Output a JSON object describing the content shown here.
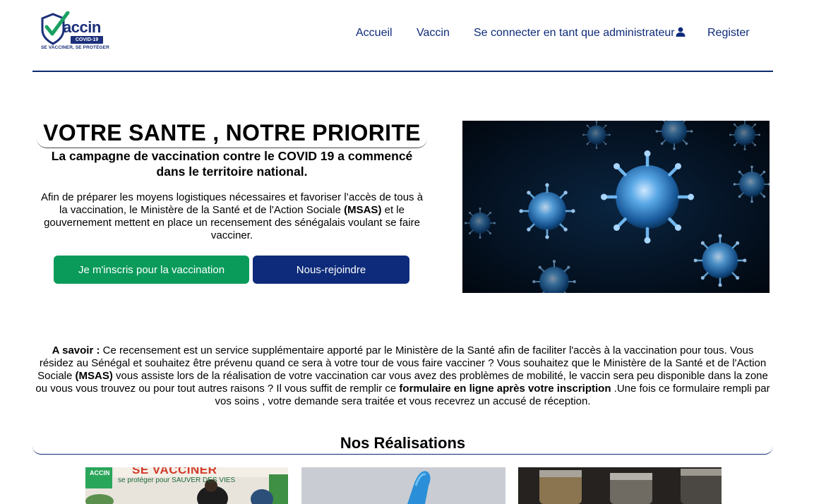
{
  "logo": {
    "brand": "accin",
    "badge": "COVID-19",
    "tagline": "SE VACCINER, SE PROTÉGER"
  },
  "nav": {
    "home": "Accueil",
    "vaccine": "Vaccin",
    "admin_login": "Se connecter en tant que administrateur",
    "register": "Register"
  },
  "hero": {
    "title": "VOTRE SANTE , NOTRE PRIORITE",
    "subtitle": "La campagne de vaccination contre le COVID 19 a commencé dans le territoire national.",
    "text_before": "Afin de préparer les moyens logistiques nécessaires et favoriser l’accès de tous à la vaccination, le Ministère de la Santé et de l'Action Sociale ",
    "text_bold": "(MSAS)",
    "text_after": " et le gouvernement mettent en place un recensement des sénégalais voulant se faire vacciner.",
    "btn_register": "Je m'inscris pour la vaccination",
    "btn_join": "Nous-rejoindre"
  },
  "info": {
    "label": "A savoir :",
    "part1": " Ce recensement est un service supplémentaire apporté par le Ministère de la Santé afin de faciliter l'accès à la vaccination pour tous. Vous résidez au Sénégal et souhaitez être prévenu quand ce sera à votre tour de vous faire vacciner ? Vous souhaitez que le Ministère de la Santé et de l'Action Sociale ",
    "msas": "(MSAS)",
    "part2": " vous assiste lors de la réalisation de votre vaccination car vous avez des problèmes de mobilité, le vaccin sera peu disponible dans la zone ou vous vous trouvez ou pour tout autres raisons ? Il vous suffit de remplir ce ",
    "form_link": "formulaire en ligne après votre inscription",
    "part3": " .Une fois ce formulaire rempli par vos soins , votre demande sera traitée et vous recevrez un accusé de réception."
  },
  "realisations": {
    "title": "Nos Réalisations",
    "card1_banner": "SE VACCINER",
    "card1_sub": "se protéger pour SAUVER DES VIES",
    "card1_logo": "ACCIN"
  },
  "colors": {
    "navy": "#0d2b7a",
    "green": "#0a9b5b"
  },
  "icons": {
    "user": "user-icon",
    "logo_check": "check-shield-icon"
  }
}
